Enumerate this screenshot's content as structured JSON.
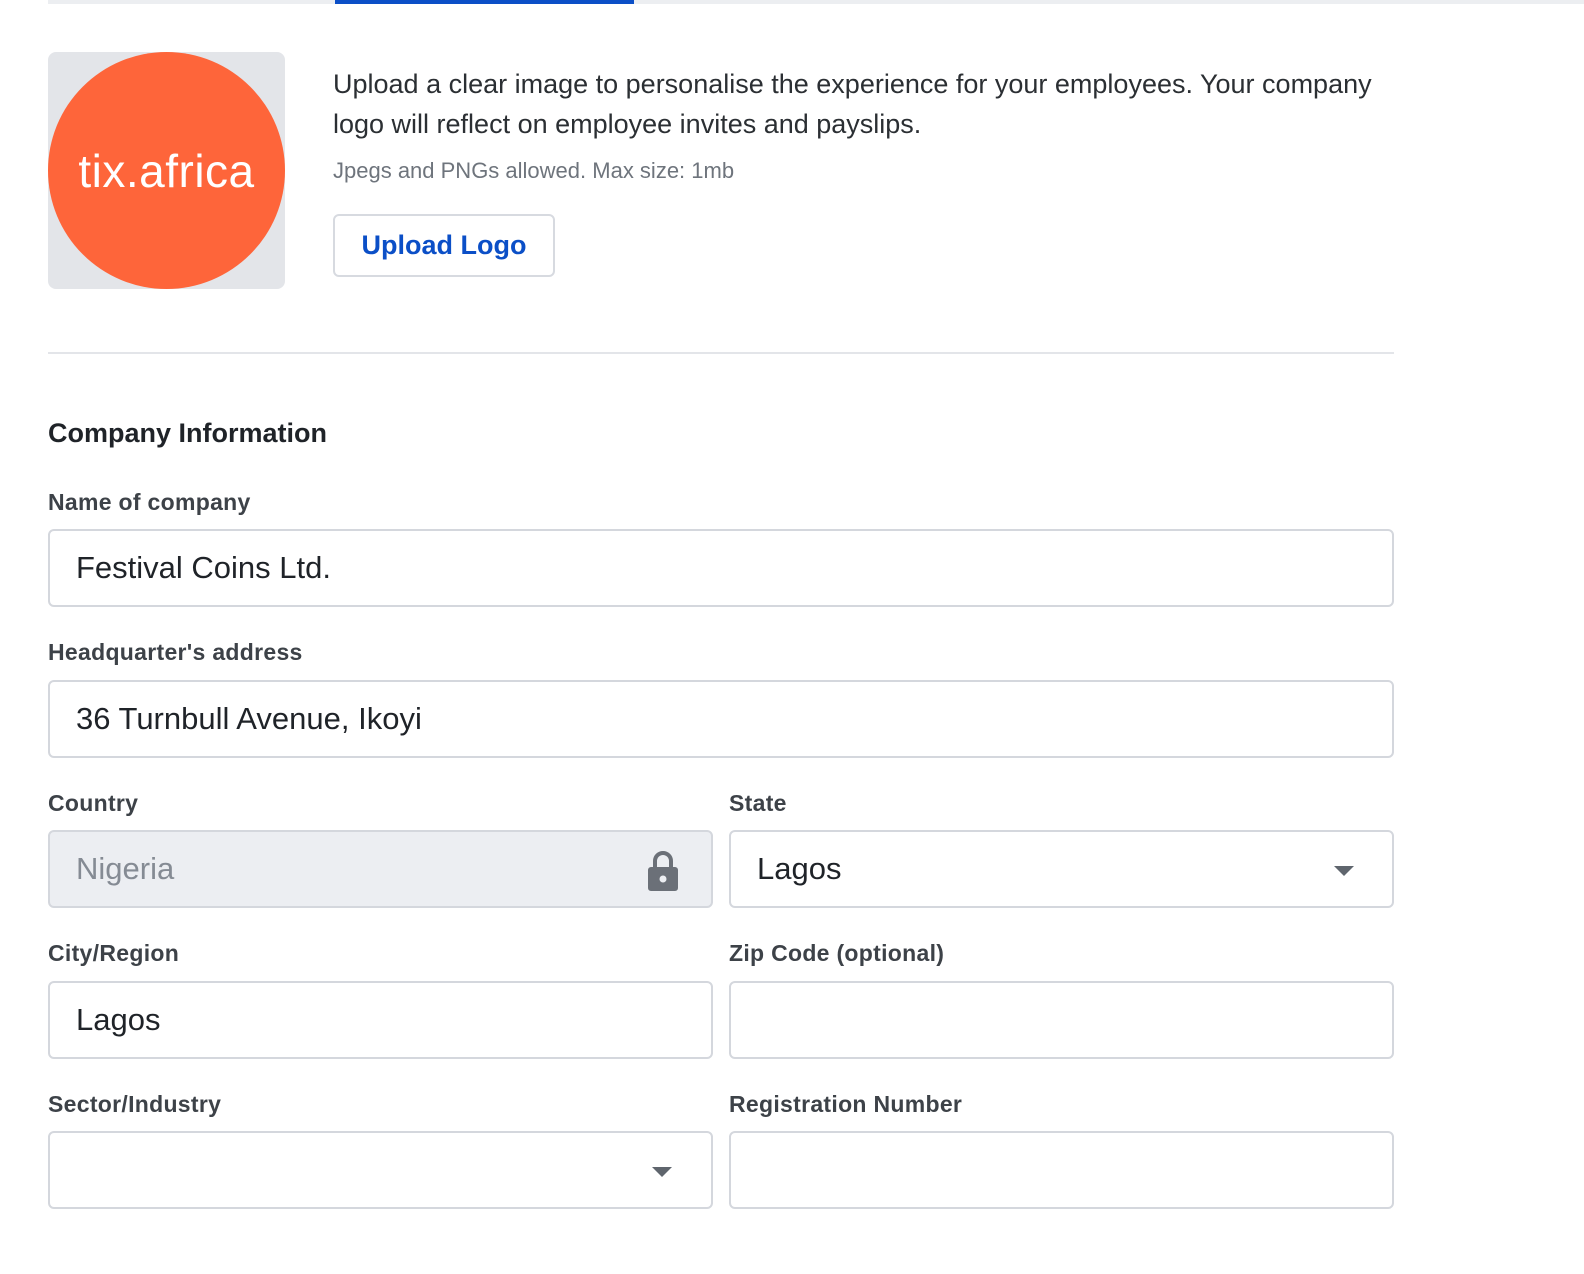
{
  "tabs": {
    "active_indicator_color": "#0b4fc7"
  },
  "logo": {
    "text": "tix.africa",
    "background_color": "#fe653a"
  },
  "upload": {
    "description": "Upload a clear image to personalise the experience for your employees. Your company logo will reflect on employee invites and payslips.",
    "hint": "Jpegs and PNGs allowed. Max size: 1mb",
    "button_label": "Upload Logo"
  },
  "company_info": {
    "title": "Company Information",
    "fields": {
      "name": {
        "label": "Name of company",
        "value": "Festival Coins Ltd."
      },
      "address": {
        "label": "Headquarter's address",
        "value": "36 Turnbull Avenue, Ikoyi"
      },
      "country": {
        "label": "Country",
        "value": "Nigeria",
        "icon": "lock-icon"
      },
      "state": {
        "label": "State",
        "value": "Lagos",
        "icon": "chevron-down-icon"
      },
      "city": {
        "label": "City/Region",
        "value": "Lagos"
      },
      "zip": {
        "label": "Zip Code (optional)",
        "value": ""
      },
      "sector": {
        "label": "Sector/Industry",
        "value": "",
        "icon": "chevron-down-icon"
      },
      "registration": {
        "label": "Registration Number",
        "value": ""
      }
    }
  }
}
